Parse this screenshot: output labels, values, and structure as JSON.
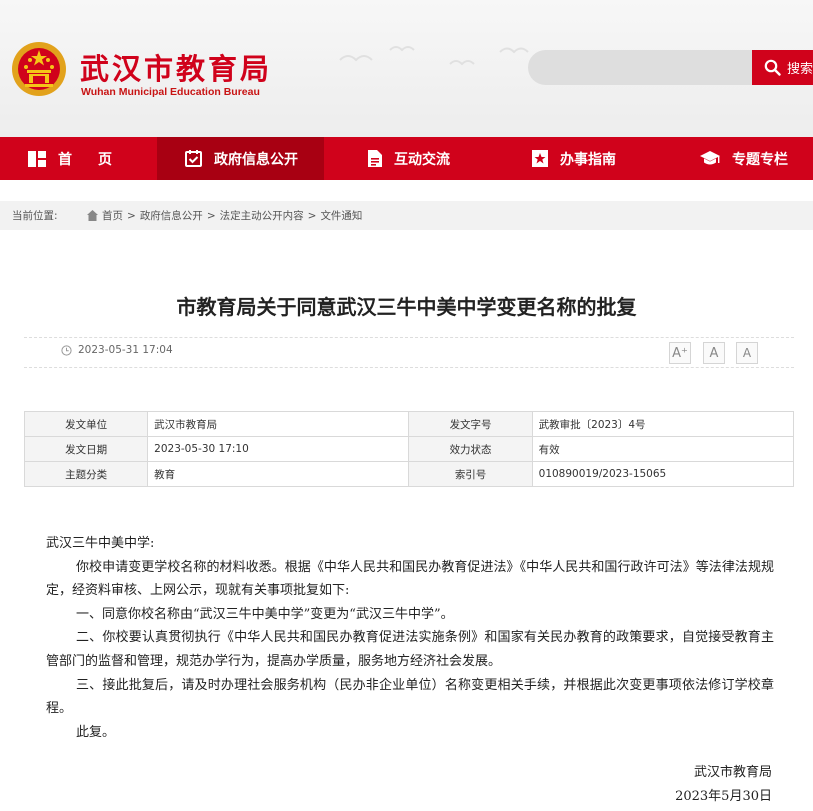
{
  "header": {
    "site_title": "武汉市教育局",
    "site_subtitle": "Wuhan Municipal Education Bureau",
    "emblem_icon": "national-emblem-icon",
    "search_placeholder": "",
    "search_label": "搜索"
  },
  "nav": {
    "items": [
      {
        "label": "首页",
        "icon": "home-icon"
      },
      {
        "label": "政府信息公开",
        "icon": "checklist-icon"
      },
      {
        "label": "互动交流",
        "icon": "document-icon"
      },
      {
        "label": "办事指南",
        "icon": "star-icon"
      },
      {
        "label": "专题专栏",
        "icon": "graduation-cap-icon"
      }
    ],
    "active_index": 1
  },
  "breadcrumb": {
    "label": "当前位置:",
    "items": [
      "首页",
      "政府信息公开",
      "法定主动公开内容",
      "文件通知"
    ],
    "separator": ">"
  },
  "article": {
    "title": "市教育局关于同意武汉三牛中美中学变更名称的批复",
    "publish_time": "2023-05-31 17:04",
    "font_sizes": [
      "A⁺",
      "A",
      "A"
    ]
  },
  "info": {
    "rows": [
      [
        {
          "k": "发文单位",
          "v": "武汉市教育局"
        },
        {
          "k": "发文字号",
          "v": "武教审批〔2023〕4号"
        }
      ],
      [
        {
          "k": "发文日期",
          "v": "2023-05-30 17:10"
        },
        {
          "k": "效力状态",
          "v": "有效"
        }
      ],
      [
        {
          "k": "主题分类",
          "v": "教育"
        },
        {
          "k": "索引号",
          "v": "010890019/2023-15065"
        }
      ]
    ]
  },
  "body": {
    "salutation": "武汉三牛中美中学:",
    "p1": "你校申请变更学校名称的材料收悉。根据《中华人民共和国民办教育促进法》《中华人民共和国行政许可法》等法律法规规定，经资料审核、上网公示，现就有关事项批复如下:",
    "p2": "一、同意你校名称由“武汉三牛中美中学”变更为“武汉三牛中学”。",
    "p3": "二、你校要认真贯彻执行《中华人民共和国民办教育促进法实施条例》和国家有关民办教育的政策要求，自觉接受教育主管部门的监督和管理，规范办学行为，提高办学质量，服务地方经济社会发展。",
    "p4": "三、接此批复后，请及时办理社会服务机构（民办非企业单位）名称变更相关手续，并根据此次变更事项依法修订学校章程。",
    "p5": "此复。",
    "signature": "武汉市教育局",
    "sign_date": "2023年5月30日"
  },
  "colors": {
    "brand_red": "#d0021b",
    "nav_active": "#a80012"
  }
}
